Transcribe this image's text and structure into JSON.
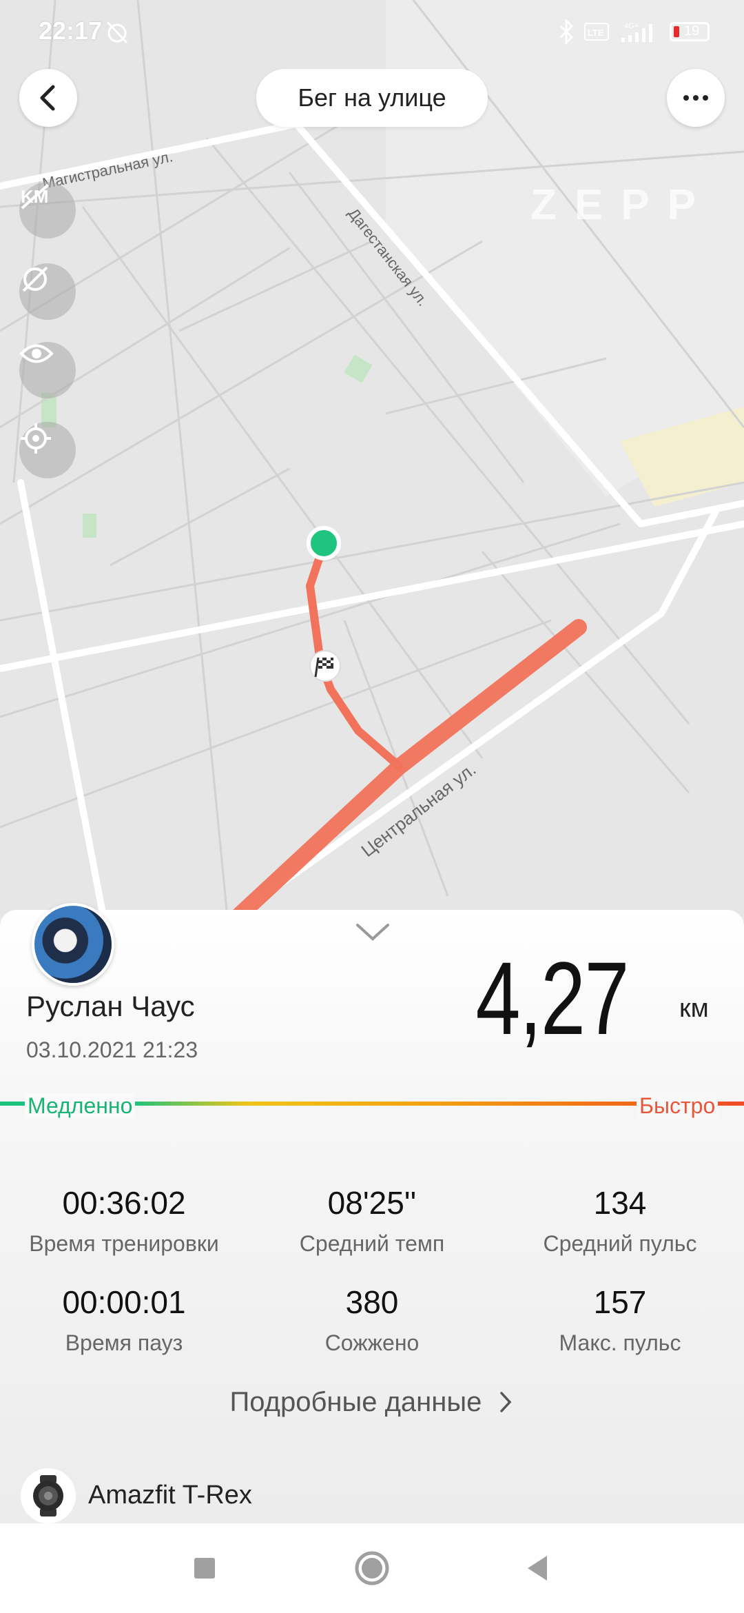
{
  "status_bar": {
    "time": "22:17",
    "battery": "19"
  },
  "header": {
    "title": "Бег на улице",
    "back_icon": "back-arrow-icon",
    "more_icon": "more-dots-icon"
  },
  "map": {
    "watermark": "ZEPP",
    "streets": [
      {
        "label": "Магистральная ул."
      },
      {
        "label": "Дагестанская ул."
      },
      {
        "label": "Центральная ул."
      }
    ],
    "route_color": "#f1735b",
    "start_marker_color": "#1fc47f",
    "tools": [
      "km-marker-off-icon",
      "pace-off-icon",
      "eye-icon",
      "locate-icon"
    ]
  },
  "profile": {
    "name": "Руслан Чаус",
    "date": "03.10.2021 21:23"
  },
  "distance": {
    "value": "4,27",
    "unit": "км"
  },
  "speed_legend": {
    "slow": "Медленно",
    "fast": "Быстро"
  },
  "stats": [
    {
      "value": "00:36:02",
      "label": "Время тренировки"
    },
    {
      "value": "08'25''",
      "label": "Средний темп"
    },
    {
      "value": "134",
      "label": "Средний пульс"
    },
    {
      "value": "00:00:01",
      "label": "Время пауз"
    },
    {
      "value": "380",
      "label": "Сожжено"
    },
    {
      "value": "157",
      "label": "Макс. пульс"
    }
  ],
  "details_link": "Подробные данные",
  "device": {
    "name": "Amazfit T-Rex"
  },
  "colors": {
    "accent_green": "#19b374",
    "accent_red": "#e8563b"
  }
}
